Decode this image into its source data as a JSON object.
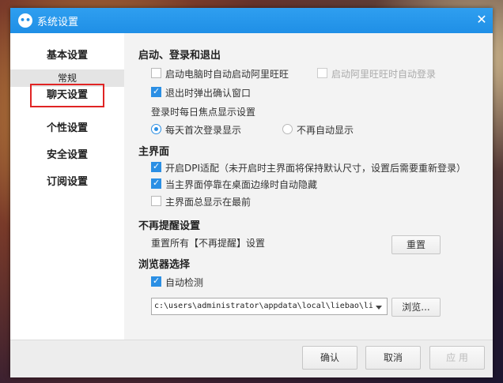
{
  "window": {
    "title": "系统设置",
    "icon": "app-icon",
    "close": "✕"
  },
  "sidebar": {
    "items": [
      {
        "label": "基本设置"
      },
      {
        "label": "常规"
      },
      {
        "label": "聊天设置"
      },
      {
        "label": "个性设置"
      },
      {
        "label": "安全设置"
      },
      {
        "label": "订阅设置"
      }
    ]
  },
  "content": {
    "startup": {
      "heading": "启动、登录和退出",
      "auto_start": "启动电脑时自动启动阿里旺旺",
      "auto_login": "启动阿里旺旺时自动登录",
      "exit_confirm": "退出时弹出确认窗口",
      "focus_heading": "登录时每日焦点显示设置",
      "radio_daily": "每天首次登录显示",
      "radio_never": "不再自动显示"
    },
    "main_ui": {
      "heading": "主界面",
      "dpi": "开启DPI适配（未开启时主界面将保持默认尺寸，设置后需要重新登录）",
      "auto_hide": "当主界面停靠在桌面边缘时自动隐藏",
      "always_top": "主界面总显示在最前"
    },
    "reminders": {
      "heading": "不再提醒设置",
      "reset_label": "重置所有【不再提醒】设置",
      "reset_button": "重置"
    },
    "browser": {
      "heading": "浏览器选择",
      "auto_detect": "自动检测",
      "path_value": "c:\\users\\administrator\\appdata\\local\\liebao\\li",
      "browse_button": "浏览..."
    }
  },
  "footer": {
    "ok": "确认",
    "cancel": "取消",
    "apply": "应 用"
  },
  "colors": {
    "titlebar": "#1f8fe6",
    "accent": "#2b8fe4",
    "highlight": "#e02424"
  }
}
